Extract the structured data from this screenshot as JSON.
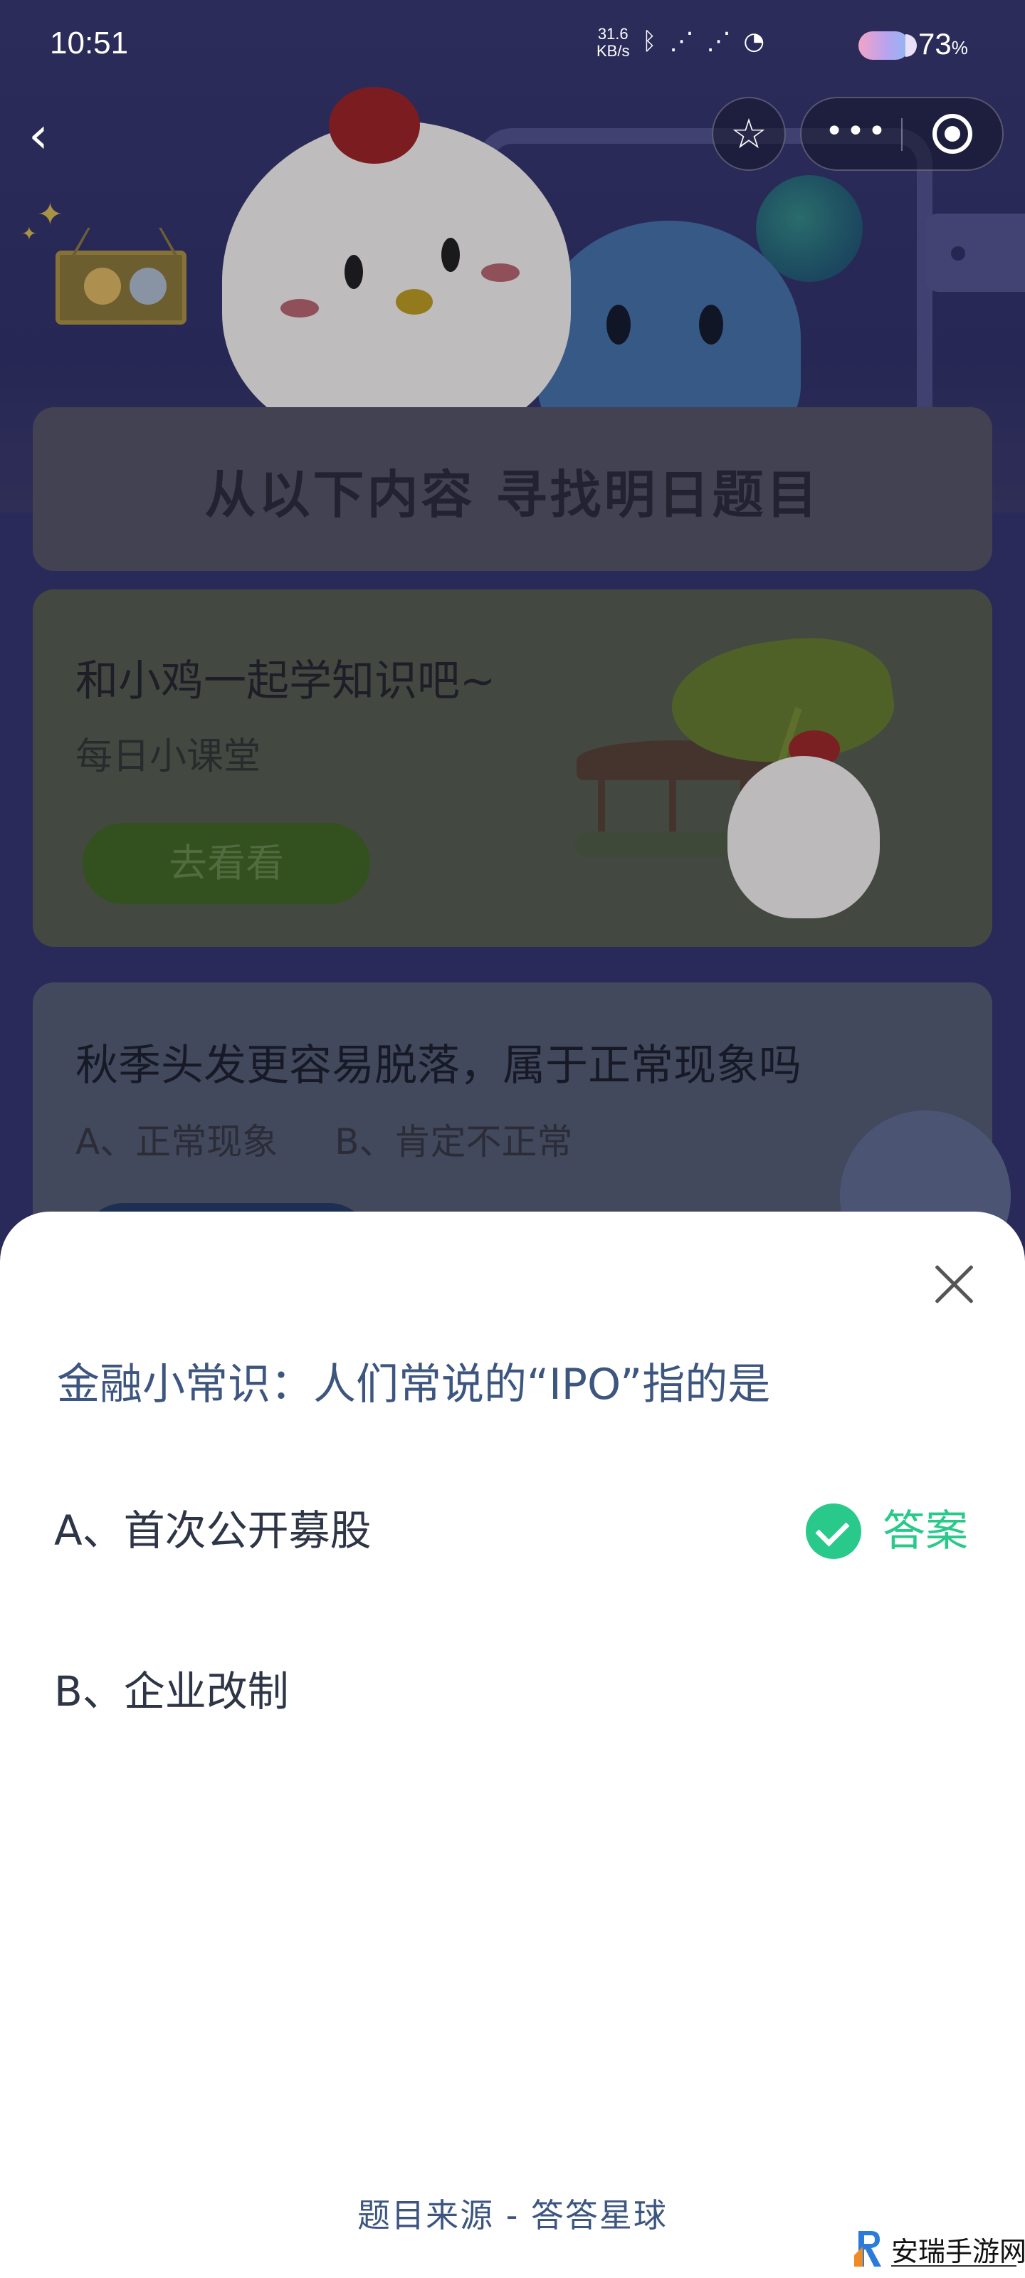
{
  "status_bar": {
    "time": "10:51",
    "net_speed_value": "31.6",
    "net_speed_unit": "KB/s",
    "battery": "73",
    "battery_unit": "%"
  },
  "nav": {
    "back_icon": "chevron-left-icon",
    "favorite_icon": "star-icon",
    "more_icon": "more-dots-icon",
    "target_icon": "target-icon"
  },
  "background": {
    "section_title": "从以下内容 寻找明日题目",
    "green_card": {
      "title": "和小鸡一起学知识吧~",
      "subtitle": "每日小课堂",
      "button": "去看看"
    },
    "blue_card": {
      "title": "秋季头发更容易脱落，属于正常现象吗",
      "option_a": "A、正常现象",
      "option_b": "B、肯定不正常"
    }
  },
  "sheet": {
    "question": "金融小常识：人们常说的“IPO”指的是",
    "options": [
      {
        "label": "A、首次公开募股",
        "is_answer": true
      },
      {
        "label": "B、企业改制",
        "is_answer": false
      }
    ],
    "answer_label": "答案",
    "answer_color": "#29c98b",
    "source": "题目来源 - 答答星球"
  },
  "watermark": {
    "text": "安瑞手游网"
  }
}
